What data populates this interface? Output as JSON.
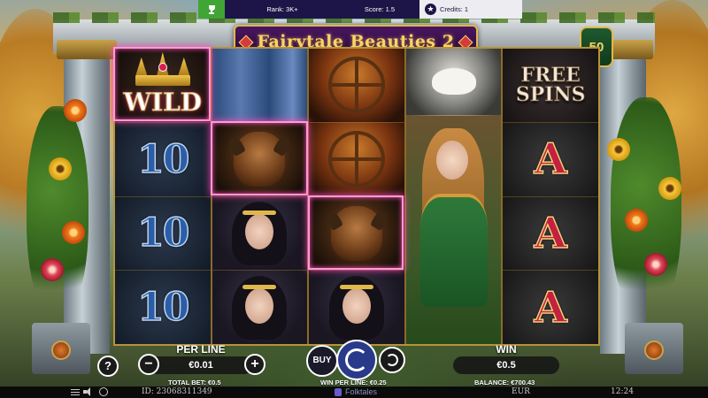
{
  "topbar": {
    "rank": "Rank: 3K+",
    "score": "Score: 1.5",
    "credits": "Credits: 1"
  },
  "game": {
    "title": "Fairytale Beauties 2",
    "lines": "50"
  },
  "reels": [
    [
      "WILD",
      "10",
      "10",
      "10"
    ],
    [
      "curtain",
      "beast",
      "belle",
      "belle"
    ],
    [
      "spinning-wheel",
      "spinning-wheel",
      "beast",
      "belle"
    ],
    [
      "mask",
      "rapunzel",
      "rapunzel",
      "rapunzel"
    ],
    [
      "FREE SPINS",
      "A",
      "A",
      "A"
    ]
  ],
  "symbols": {
    "wild_label": "WILD",
    "ten_label": "10",
    "a_label": "A",
    "free_line1": "FREE",
    "free_line2": "SPINS"
  },
  "controls": {
    "help": "?",
    "per_line_label": "PER LINE",
    "per_line_value": "€0.01",
    "minus": "−",
    "plus": "+",
    "buy": "BUY",
    "win_label": "WIN",
    "win_value": "€0.5"
  },
  "info": {
    "total_bet": "TOTAL BET: €0.5",
    "win_per_line": "WIN PER LINE: €0.25",
    "balance": "BALANCE: €700.43"
  },
  "status": {
    "id": "ID: 23068311349",
    "provider": "Folktales",
    "currency": "EUR",
    "time": "12:24"
  },
  "colors": {
    "topbar_bg": "#1d1547",
    "trophy_green": "#3fa535",
    "gold": "#e0b84a",
    "highlight": "#ff9ad8"
  }
}
